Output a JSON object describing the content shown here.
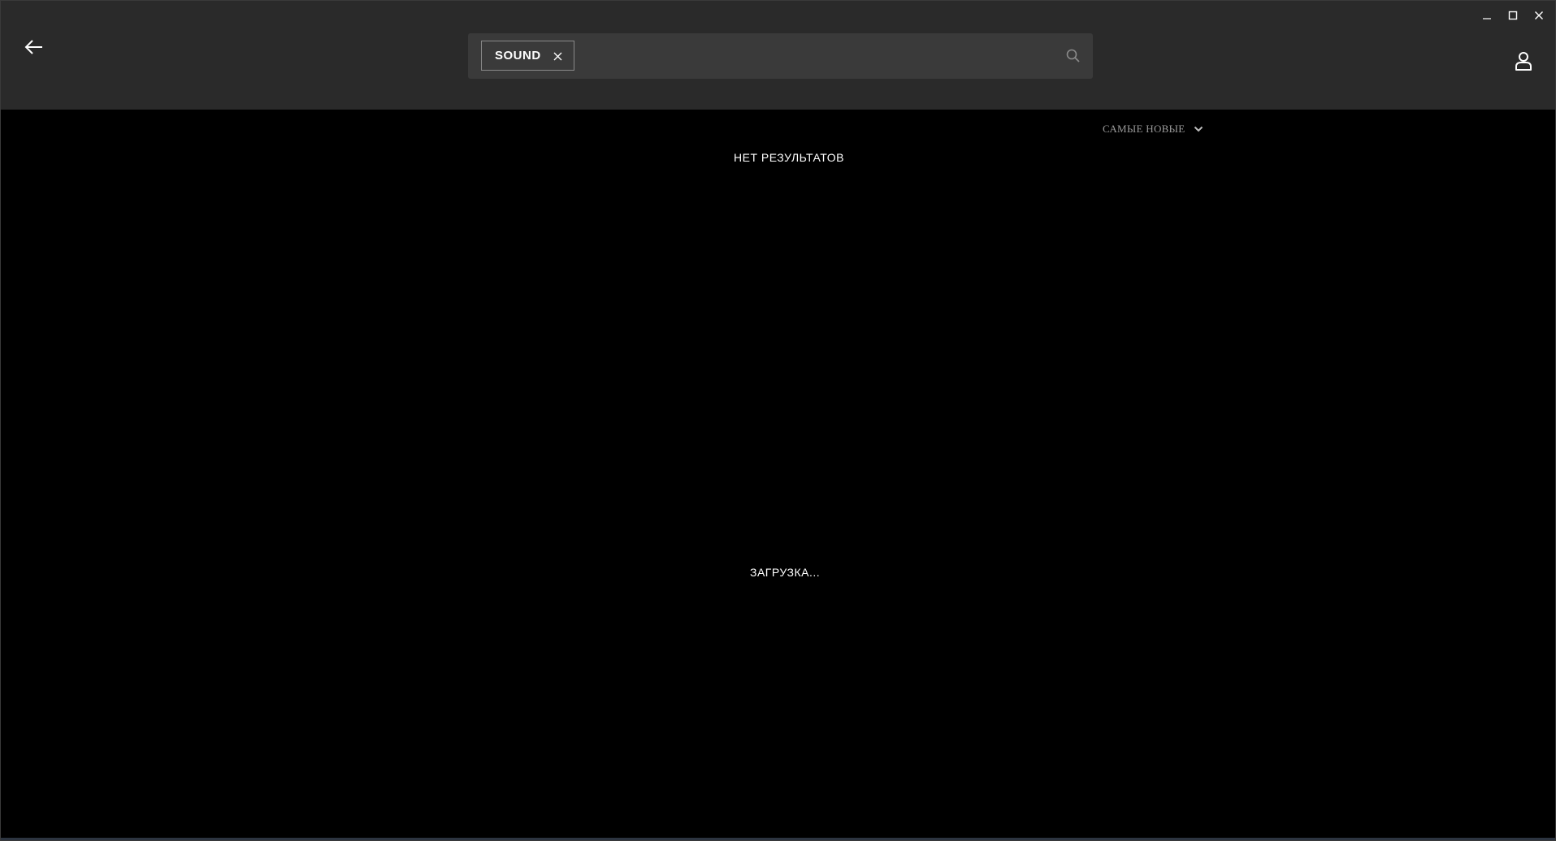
{
  "window": {
    "controls": {
      "minimize": "minimize-icon",
      "maximize": "maximize-icon",
      "close": "close-icon"
    }
  },
  "header": {
    "back_icon": "arrow-left-icon",
    "search": {
      "tag_label": "SOUND",
      "tag_remove_icon": "close-icon",
      "input_value": "",
      "input_placeholder": "",
      "icon": "search-icon"
    },
    "user_icon": "user-icon"
  },
  "content": {
    "sort": {
      "selected": "САМЫЕ НОВЫЕ",
      "icon": "chevron-down-icon"
    },
    "no_results": "НЕТ РЕЗУЛЬТАТОВ",
    "loading": "ЗАГРУЗКА..."
  },
  "colors": {
    "background": "#000000",
    "header": "#2a2a2a",
    "search_box": "#3a3a3a",
    "muted_text": "#9a9a9a",
    "text": "#ffffff"
  }
}
